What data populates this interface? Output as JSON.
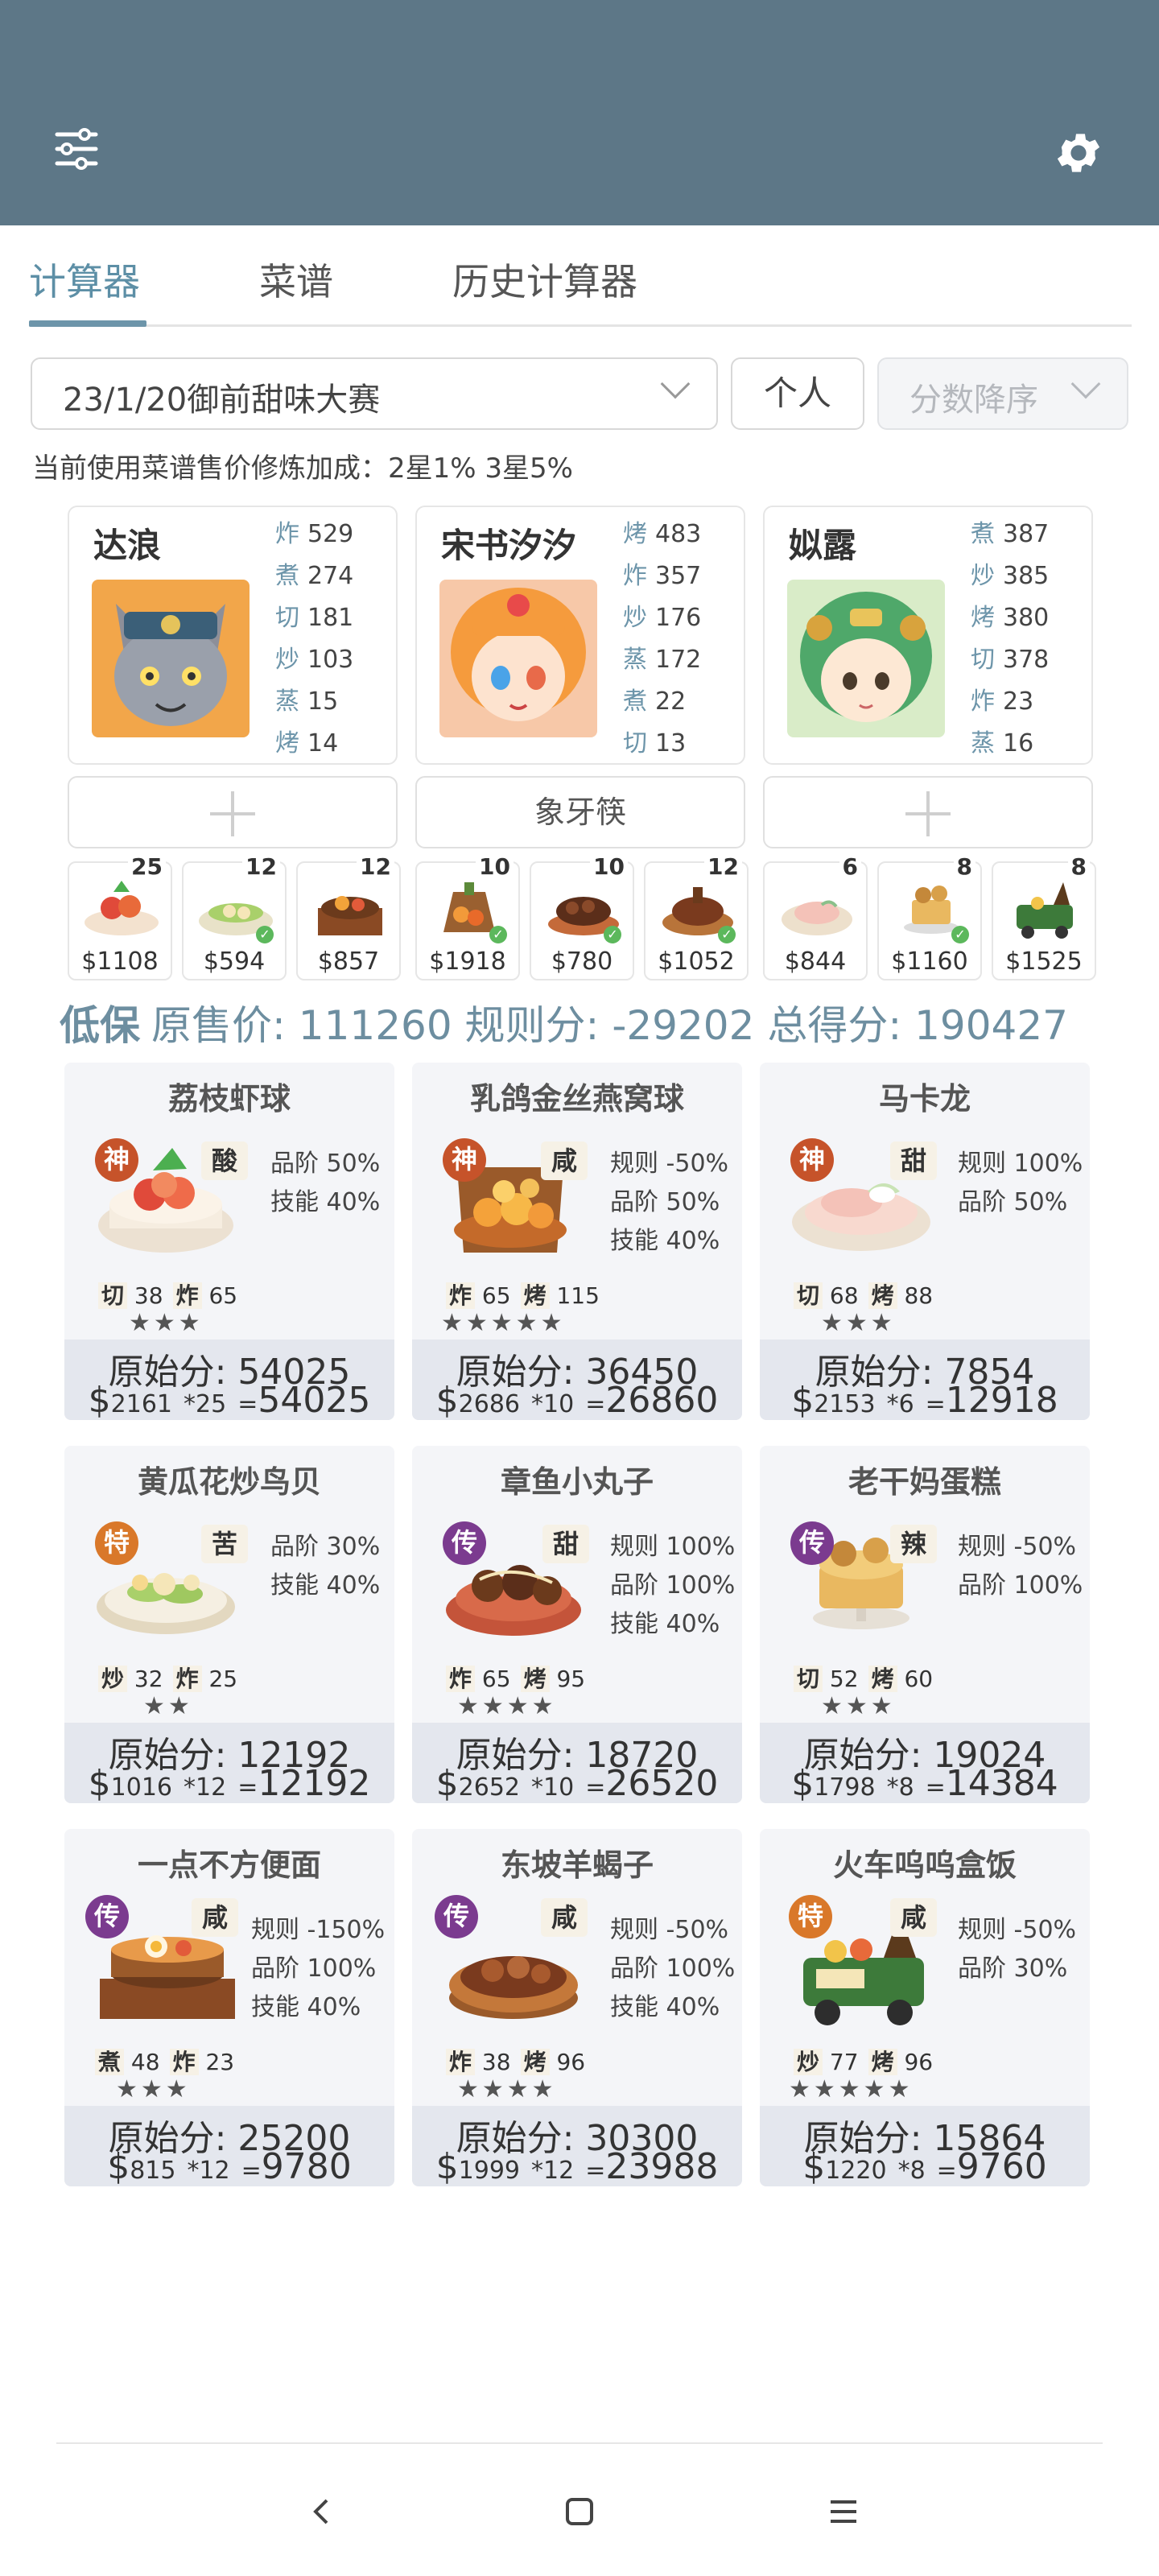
{
  "colors": {
    "appbar": "#5d7787",
    "accent": "#5d8fa6",
    "tier_god": "#c6532a",
    "tier_legend": "#7b3b8f",
    "tier_special": "#d9782a"
  },
  "tabs": [
    {
      "label": "计算器",
      "active": true
    },
    {
      "label": "菜谱"
    },
    {
      "label": "历史计算器"
    }
  ],
  "controls": {
    "event": "23/1/20御前甜味大赛",
    "person": "个人",
    "sort": "分数降序"
  },
  "note": "当前使用菜谱售价修炼加成：2星1% 3星5%",
  "chefs": [
    {
      "name": "达浪",
      "skills": [
        {
          "k": "炸",
          "v": "529"
        },
        {
          "k": "煮",
          "v": "274"
        },
        {
          "k": "切",
          "v": "181"
        },
        {
          "k": "炒",
          "v": "103"
        },
        {
          "k": "蒸",
          "v": "15"
        },
        {
          "k": "烤",
          "v": "14"
        }
      ],
      "equip": ""
    },
    {
      "name": "宋书汐汐",
      "skills": [
        {
          "k": "烤",
          "v": "483"
        },
        {
          "k": "炸",
          "v": "357"
        },
        {
          "k": "炒",
          "v": "176"
        },
        {
          "k": "蒸",
          "v": "172"
        },
        {
          "k": "煮",
          "v": "22"
        },
        {
          "k": "切",
          "v": "13"
        }
      ],
      "equip": "象牙筷"
    },
    {
      "name": "姒露",
      "skills": [
        {
          "k": "煮",
          "v": "387"
        },
        {
          "k": "炒",
          "v": "385"
        },
        {
          "k": "烤",
          "v": "380"
        },
        {
          "k": "切",
          "v": "378"
        },
        {
          "k": "炸",
          "v": "23"
        },
        {
          "k": "蒸",
          "v": "16"
        }
      ],
      "equip": ""
    }
  ],
  "recipe_cards": [
    {
      "count": "25",
      "price": "$1108"
    },
    {
      "count": "12",
      "price": "$594"
    },
    {
      "count": "12",
      "price": "$857"
    },
    {
      "count": "10",
      "price": "$1918"
    },
    {
      "count": "10",
      "price": "$780"
    },
    {
      "count": "12",
      "price": "$1052"
    },
    {
      "count": "6",
      "price": "$844"
    },
    {
      "count": "8",
      "price": "$1160"
    },
    {
      "count": "8",
      "price": "$1525"
    }
  ],
  "totals": {
    "label": "低保",
    "orig_label": "原售价:",
    "orig": "111260",
    "rule_label": "规则分:",
    "rule": "-29202",
    "total_label": "总得分:",
    "total": "190427"
  },
  "dishes": [
    {
      "name": "荔枝虾球",
      "tier": "神",
      "flavor": "酸",
      "mods": [
        "品阶 50%",
        "技能 40%"
      ],
      "s1k": "切",
      "s1v": "38",
      "s2k": "炸",
      "s2v": "65",
      "stars": "★★★",
      "orig": "原始分: 54025",
      "price": "2161",
      "mult": "*25",
      "result": "54025"
    },
    {
      "name": "乳鸽金丝燕窝球",
      "tier": "神",
      "flavor": "咸",
      "mods": [
        "规则 -50%",
        "品阶 50%",
        "技能 40%"
      ],
      "s1k": "炸",
      "s1v": "65",
      "s2k": "烤",
      "s2v": "115",
      "stars": "★★★★★",
      "orig": "原始分: 36450",
      "price": "2686",
      "mult": "*10",
      "result": "26860"
    },
    {
      "name": "马卡龙",
      "tier": "神",
      "flavor": "甜",
      "mods": [
        "规则 100%",
        "品阶 50%"
      ],
      "s1k": "切",
      "s1v": "68",
      "s2k": "烤",
      "s2v": "88",
      "stars": "★★★",
      "orig": "原始分: 7854",
      "price": "2153",
      "mult": "*6",
      "result": "12918"
    },
    {
      "name": "黄瓜花炒鸟贝",
      "tier": "特",
      "flavor": "苦",
      "mods": [
        "品阶 30%",
        "技能 40%"
      ],
      "s1k": "炒",
      "s1v": "32",
      "s2k": "炸",
      "s2v": "25",
      "stars": "★★",
      "orig": "原始分: 12192",
      "price": "1016",
      "mult": "*12",
      "result": "12192"
    },
    {
      "name": "章鱼小丸子",
      "tier": "传",
      "flavor": "甜",
      "mods": [
        "规则 100%",
        "品阶 100%",
        "技能 40%"
      ],
      "s1k": "炸",
      "s1v": "65",
      "s2k": "烤",
      "s2v": "95",
      "stars": "★★★★",
      "orig": "原始分: 18720",
      "price": "2652",
      "mult": "*10",
      "result": "26520"
    },
    {
      "name": "老干妈蛋糕",
      "tier": "传",
      "flavor": "辣",
      "mods": [
        "规则 -50%",
        "品阶 100%"
      ],
      "s1k": "切",
      "s1v": "52",
      "s2k": "烤",
      "s2v": "60",
      "stars": "★★★",
      "orig": "原始分: 19024",
      "price": "1798",
      "mult": "*8",
      "result": "14384"
    },
    {
      "name": "一点不方便面",
      "tier": "传",
      "flavor": "咸",
      "mods": [
        "规则 -150%",
        "品阶 100%",
        "技能 40%"
      ],
      "s1k": "煮",
      "s1v": "48",
      "s2k": "炸",
      "s2v": "23",
      "stars": "★★★",
      "orig": "原始分: 25200",
      "price": "815",
      "mult": "*12",
      "result": "9780"
    },
    {
      "name": "东坡羊蝎子",
      "tier": "传",
      "flavor": "咸",
      "mods": [
        "规则 -50%",
        "品阶 100%",
        "技能 40%"
      ],
      "s1k": "炸",
      "s1v": "38",
      "s2k": "烤",
      "s2v": "96",
      "stars": "★★★★",
      "orig": "原始分: 30300",
      "price": "1999",
      "mult": "*12",
      "result": "23988"
    },
    {
      "name": "火车呜呜盒饭",
      "tier": "特",
      "flavor": "咸",
      "mods": [
        "规则 -50%",
        "品阶 30%"
      ],
      "s1k": "炒",
      "s1v": "77",
      "s2k": "烤",
      "s2v": "96",
      "stars": "★★★★★",
      "orig": "原始分: 15864",
      "price": "1220",
      "mult": "*8",
      "result": "9760"
    }
  ],
  "icons": {
    "menu": "sliders-icon",
    "settings": "gear-icon",
    "back": "back-icon",
    "home": "home-icon",
    "recents": "recents-icon"
  }
}
